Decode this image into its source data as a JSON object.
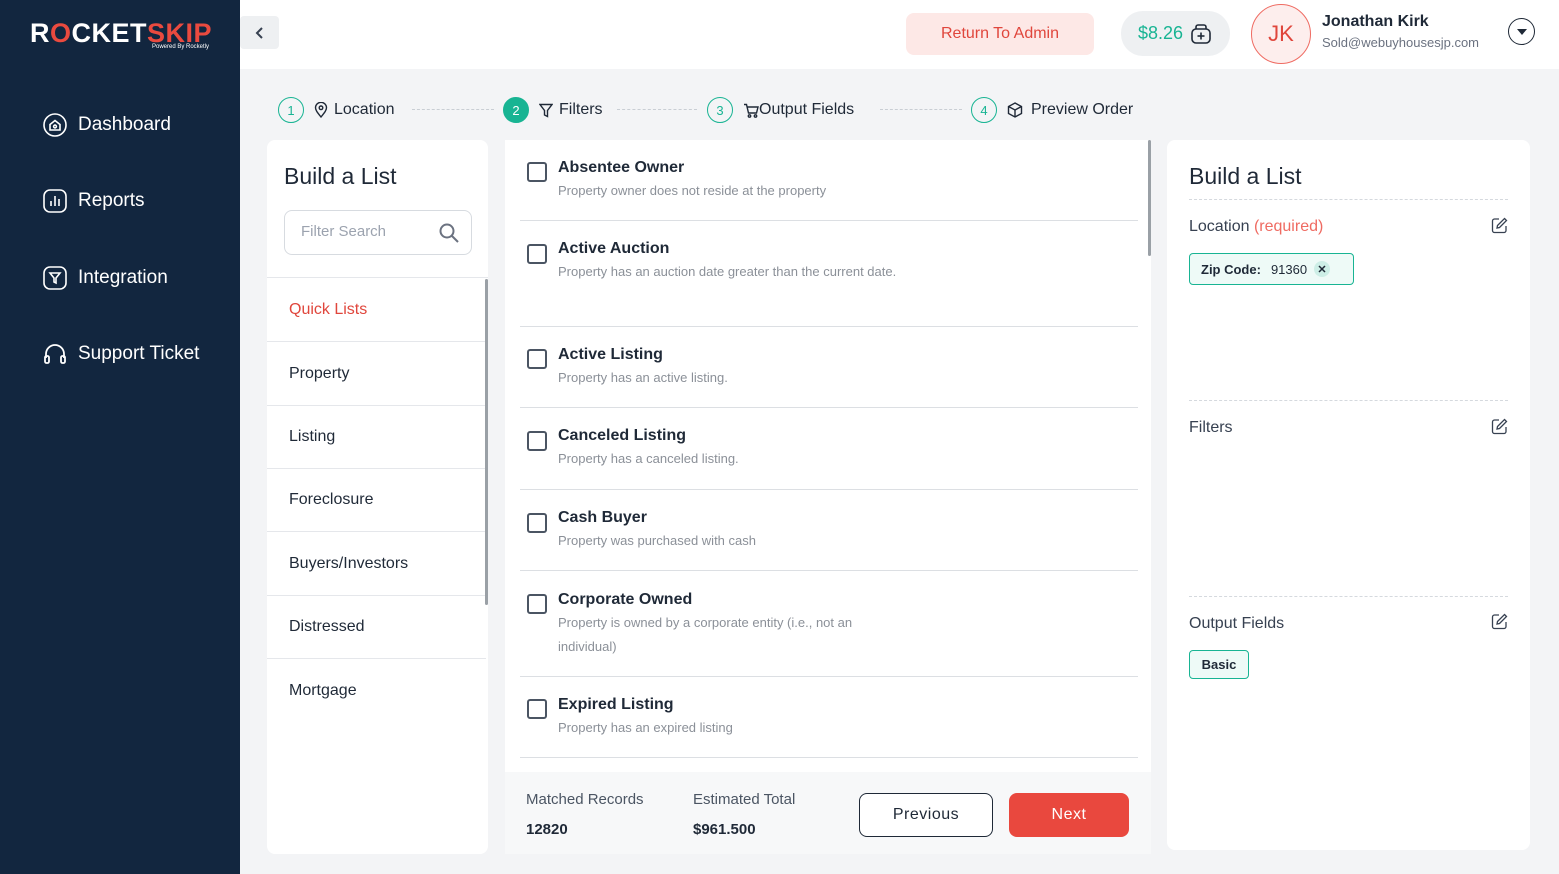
{
  "app": {
    "logo_left": "R",
    "logo_o": "O",
    "logo_mid": "CKET",
    "logo_right": "SKIP",
    "logo_sub": "Powered By Rocketly",
    "brand_color": "#e9483e",
    "accent_color": "#18b493"
  },
  "sidebar": {
    "items": [
      {
        "label": "Dashboard",
        "icon": "home-icon"
      },
      {
        "label": "Reports",
        "icon": "reports-icon"
      },
      {
        "label": "Integration",
        "icon": "integration-icon"
      },
      {
        "label": "Support Ticket",
        "icon": "headset-icon"
      }
    ]
  },
  "header": {
    "return_admin": "Return To Admin",
    "balance": "$8.26",
    "user_initials": "JK",
    "user_name": "Jonathan Kirk",
    "user_email": "Sold@webuyhousesjp.com"
  },
  "stepper": [
    {
      "num": "1",
      "label": "Location",
      "icon": "map-pin-icon",
      "active": false
    },
    {
      "num": "2",
      "label": "Filters",
      "icon": "filter-icon",
      "active": true
    },
    {
      "num": "3",
      "label": "Output Fields",
      "icon": "cart-icon",
      "active": false
    },
    {
      "num": "4",
      "label": "Preview Order",
      "icon": "box-icon",
      "active": false
    }
  ],
  "categories": {
    "title": "Build a List",
    "search_placeholder": "Filter Search",
    "items": [
      "Quick Lists",
      "Property",
      "Listing",
      "Foreclosure",
      "Buyers/Investors",
      "Distressed",
      "Mortgage"
    ],
    "active": "Quick Lists"
  },
  "filters": [
    {
      "title": "Absentee Owner",
      "desc": "Property owner does not reside at the property",
      "checked": false
    },
    {
      "title": "Active Auction",
      "desc": "Property has an auction date greater than the current date.",
      "checked": false
    },
    {
      "title": "Active Listing",
      "desc": "Property has an active listing.",
      "checked": false
    },
    {
      "title": "Canceled Listing",
      "desc": "Property has a canceled listing.",
      "checked": false
    },
    {
      "title": "Cash Buyer",
      "desc": "Property was purchased with cash",
      "checked": false
    },
    {
      "title": "Corporate Owned",
      "desc": "Property is owned by a corporate entity (i.e., not an individual)",
      "checked": false
    },
    {
      "title": "Expired Listing",
      "desc": "Property has an expired listing",
      "checked": false
    }
  ],
  "footer": {
    "matched_label": "Matched Records",
    "matched_value": "12820",
    "estimated_label": "Estimated Total",
    "estimated_value": "$961.500",
    "previous": "Previous",
    "next": "Next"
  },
  "summary": {
    "title": "Build a List",
    "location_label": "Location",
    "required": "(required)",
    "zip_label": "Zip Code:",
    "zip_value": "91360",
    "filters_label": "Filters",
    "output_label": "Output Fields",
    "output_tag": "Basic"
  }
}
